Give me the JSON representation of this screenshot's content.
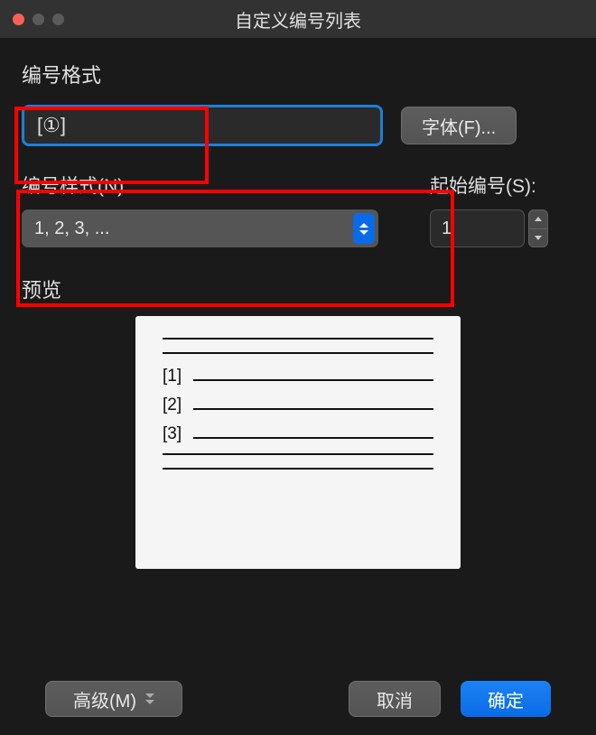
{
  "window": {
    "title": "自定义编号列表"
  },
  "sections": {
    "format_label": "编号格式",
    "preview_label": "预览"
  },
  "format": {
    "value": "[①]",
    "font_button": "字体(F)..."
  },
  "style": {
    "label": "编号样式(N):",
    "selected": "1, 2, 3, ..."
  },
  "start": {
    "label": "起始编号(S):",
    "value": "1"
  },
  "preview": {
    "items": [
      "[1]",
      "[2]",
      "[3]"
    ]
  },
  "buttons": {
    "advanced": "高级(M)",
    "cancel": "取消",
    "ok": "确定"
  }
}
